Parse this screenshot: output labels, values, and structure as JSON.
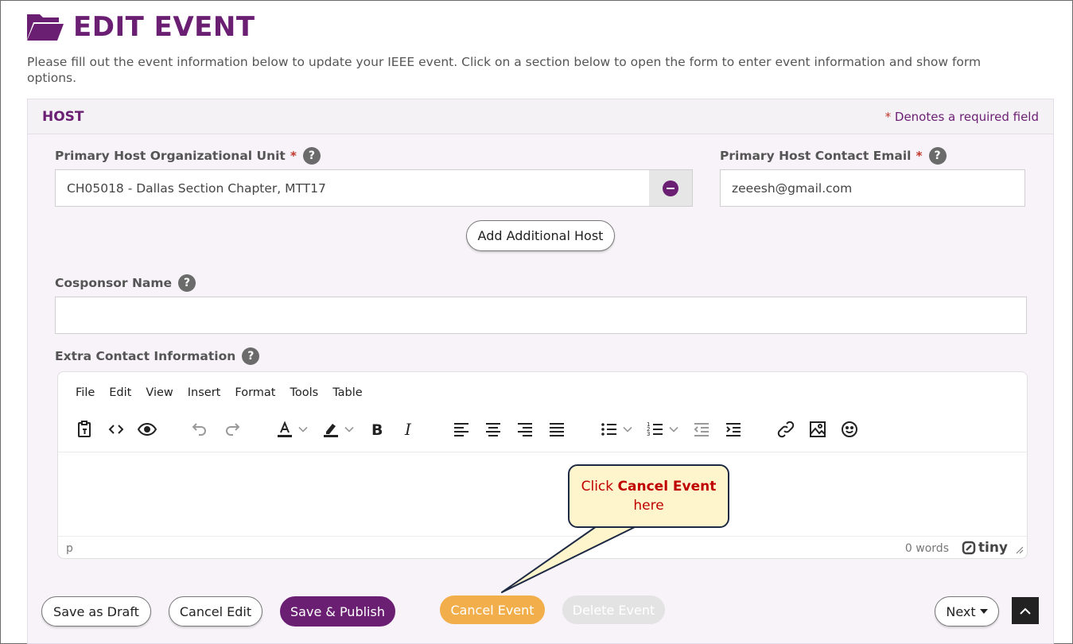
{
  "page": {
    "title": "EDIT EVENT",
    "intro": "Please fill out the event information below to update your IEEE event. Click on a section below to open the form to enter event information and show form options."
  },
  "host_section": {
    "title": "HOST",
    "required_star": "*",
    "required_note": "Denotes a required field",
    "primary_unit_label": "Primary Host Organizational Unit",
    "primary_unit_value": "CH05018 - Dallas Section Chapter, MTT17",
    "contact_email_label": "Primary Host Contact Email",
    "contact_email_value": "zeeesh@gmail.com",
    "add_host_label": "Add Additional Host",
    "cosponsor_label": "Cosponsor Name",
    "cosponsor_value": "",
    "extra_contact_label": "Extra Contact Information",
    "help_glyph": "?"
  },
  "editor": {
    "menu": [
      "File",
      "Edit",
      "View",
      "Insert",
      "Format",
      "Tools",
      "Table"
    ],
    "status_path": "p",
    "word_count": "0 words",
    "brand": "tiny"
  },
  "callout": {
    "prefix": "Click ",
    "bold": "Cancel Event",
    "suffix": "here"
  },
  "actions": {
    "save_draft": "Save as Draft",
    "cancel_edit": "Cancel Edit",
    "save_publish": "Save & Publish",
    "cancel_event": "Cancel Event",
    "delete_event": "Delete Event",
    "next": "Next"
  },
  "colors": {
    "brand_purple": "#6b1f73",
    "required_red": "#c0392b",
    "cancel_orange": "#f2ae4a",
    "callout_fill": "#fff5cc"
  }
}
